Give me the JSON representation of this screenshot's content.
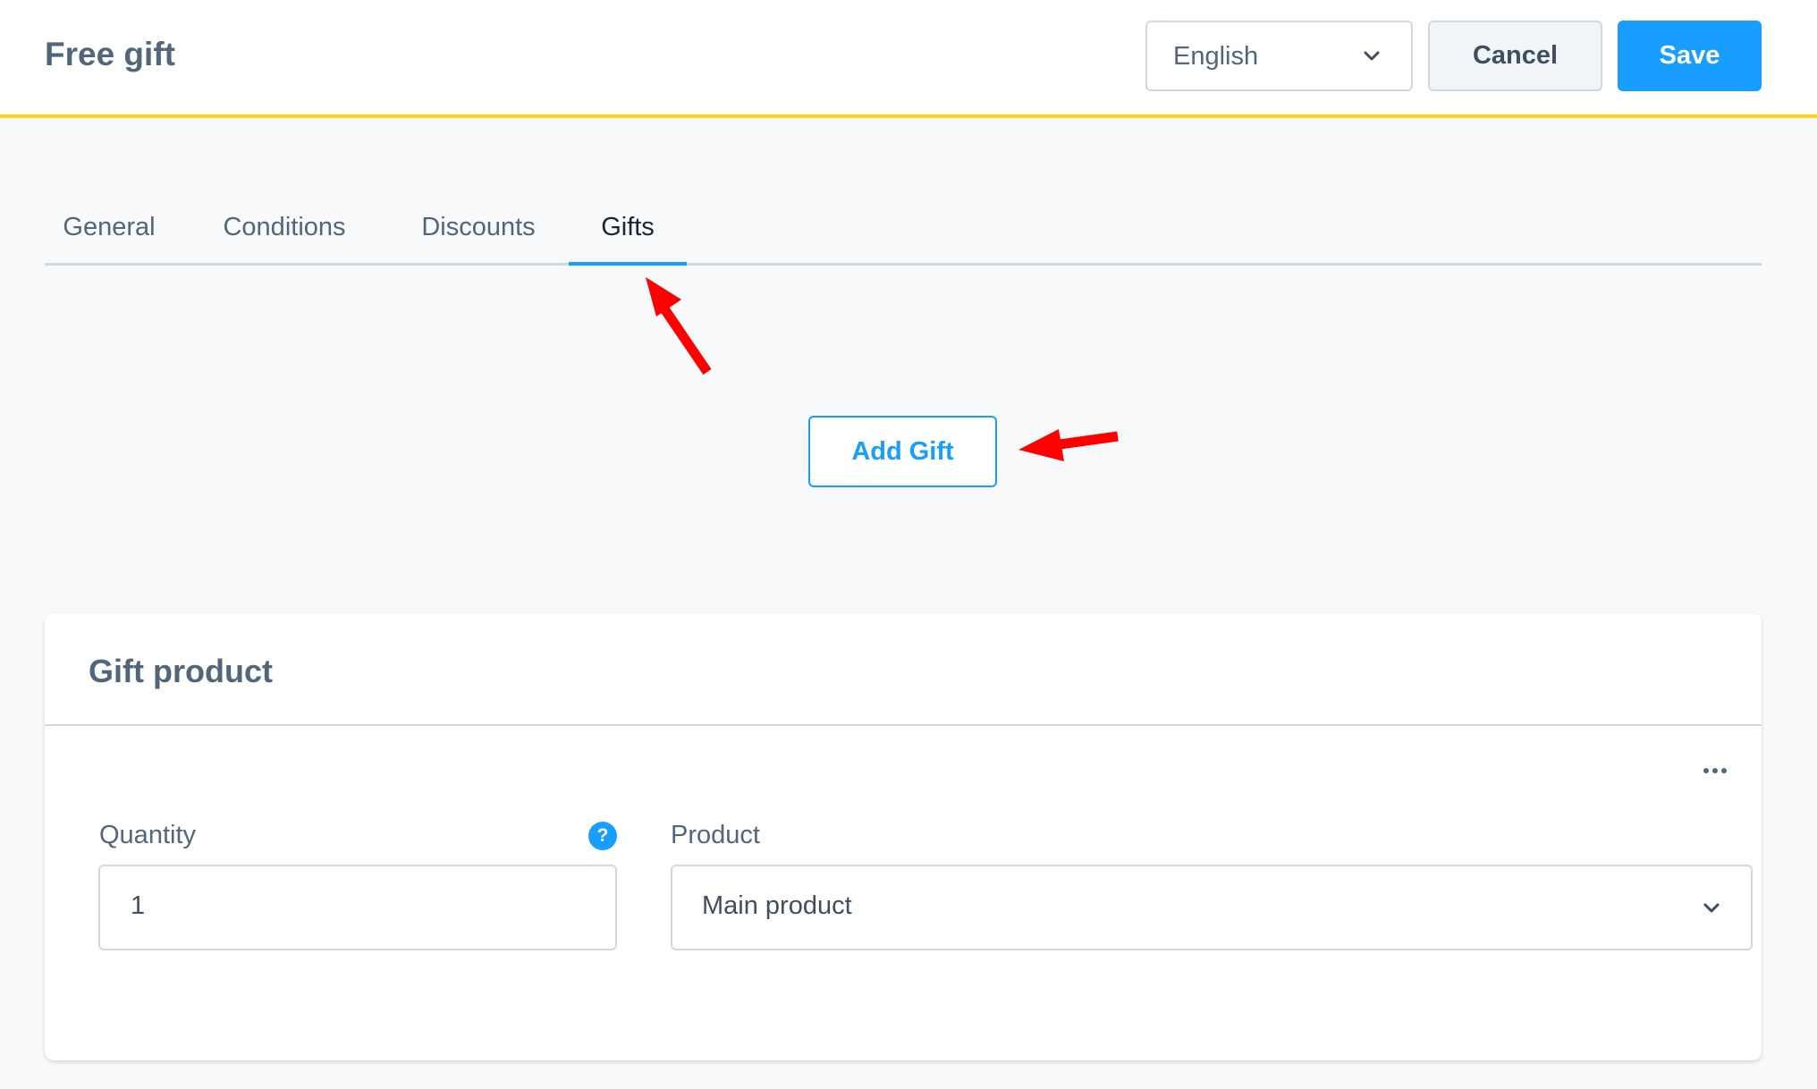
{
  "header": {
    "title": "Free gift",
    "language_select": {
      "value": "English",
      "icon": "chevron-down-icon"
    },
    "cancel_label": "Cancel",
    "save_label": "Save"
  },
  "tabs": [
    {
      "label": "General",
      "active": false
    },
    {
      "label": "Conditions",
      "active": false
    },
    {
      "label": "Discounts",
      "active": false
    },
    {
      "label": "Gifts",
      "active": true
    }
  ],
  "add_gift_label": "Add Gift",
  "gift_card": {
    "title": "Gift product",
    "menu_icon": "more-horizontal-icon",
    "quantity": {
      "label": "Quantity",
      "value": "1",
      "help_icon": "?"
    },
    "product": {
      "label": "Product",
      "value": "Main product",
      "icon": "chevron-down-icon"
    }
  },
  "colors": {
    "accent": "#189eff",
    "header_border": "#ffd21a",
    "annotation_arrow": "#ff0000"
  }
}
